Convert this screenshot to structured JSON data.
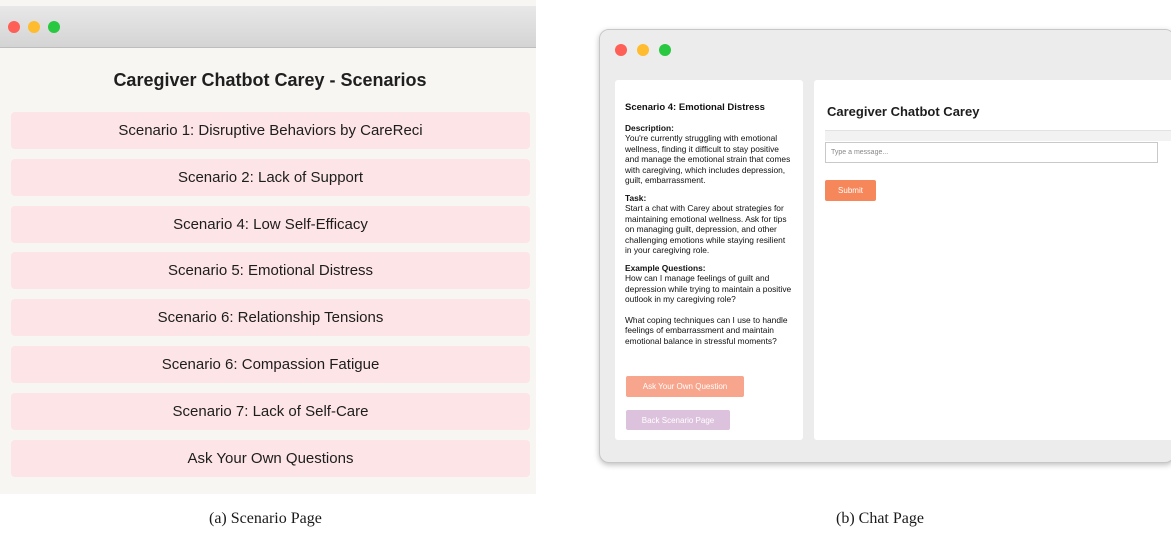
{
  "scenario_page": {
    "title": "Caregiver Chatbot Carey - Scenarios",
    "scenarios": [
      "Scenario 1: Disruptive Behaviors by CareReci",
      "Scenario 2: Lack of Support",
      "Scenario 4: Low Self-Efficacy",
      "Scenario 5: Emotional Distress",
      "Scenario 6: Relationship Tensions",
      "Scenario 6: Compassion Fatigue",
      "Scenario 7: Lack of Self-Care",
      "Ask Your Own Questions"
    ]
  },
  "chat_page": {
    "scenario_title": "Scenario 4: Emotional Distress",
    "description_label": "Description:",
    "description": "You're currently struggling with emotional wellness, finding it difficult to stay positive and manage the emotional strain that comes with caregiving, which includes depression, guilt, embarrassment.",
    "task_label": "Task:",
    "task": "Start a chat with Carey about strategies for maintaining emotional wellness. Ask for tips on managing guilt, depression, and other challenging emotions while staying resilient in your caregiving role.",
    "examples_label": "Example Questions:",
    "example_1": "How can I manage feelings of guilt and depression while trying to maintain a positive outlook in my caregiving role?",
    "example_2": "What coping techniques can I use to handle feelings of embarrassment and maintain emotional balance in stressful moments?",
    "ask_own_button": "Ask Your Own Question",
    "back_button": "Back Scenario Page",
    "chat_title": "Caregiver Chatbot Carey",
    "input_placeholder": "Type a message...",
    "submit_button": "Submit"
  },
  "captions": {
    "a": "(a) Scenario Page",
    "b": "(b) Chat Page"
  },
  "colors": {
    "scenario_button_bg": "#fde4e6",
    "ask_own_button_bg": "#f7a58c",
    "back_button_bg": "#dcc2dc",
    "submit_button_bg": "#f5875a",
    "traffic_red": "#fe5f57",
    "traffic_yellow": "#febc2e",
    "traffic_green": "#28c840"
  }
}
